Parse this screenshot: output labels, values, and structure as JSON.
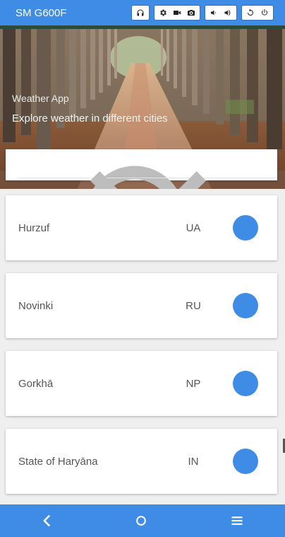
{
  "device": {
    "title": "SM G600F",
    "toolbar_groups": [
      [
        "headphones-icon"
      ],
      [
        "gear-icon",
        "video-camera-icon",
        "camera-icon"
      ],
      [
        "volume-down-icon",
        "volume-up-icon"
      ],
      [
        "rotate-icon",
        "power-icon"
      ]
    ]
  },
  "hero": {
    "title": "Weather App",
    "subtitle": "Explore weather in different cities"
  },
  "search": {
    "value": "",
    "placeholder": ""
  },
  "cities": [
    {
      "name": "Hurzuf",
      "country": "UA"
    },
    {
      "name": "Novinki",
      "country": "RU"
    },
    {
      "name": "Gorkhā",
      "country": "NP"
    },
    {
      "name": "State of Haryāna",
      "country": "IN"
    }
  ],
  "nav": {
    "items": [
      "back-icon",
      "home-icon",
      "menu-icon"
    ]
  },
  "colors": {
    "accent": "#3f8ce6",
    "dot": "#3f8ce6",
    "list_background": "#efefef"
  }
}
